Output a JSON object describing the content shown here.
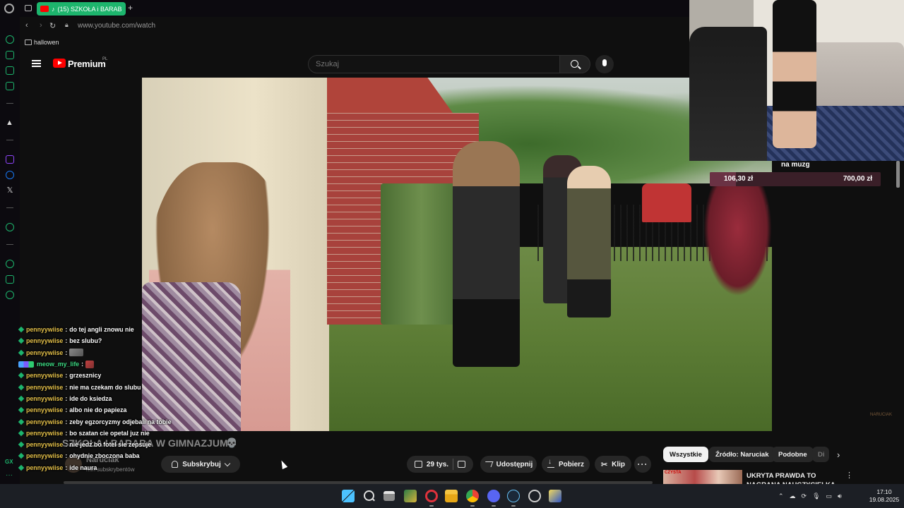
{
  "browser": {
    "tab": {
      "title": "(15) SZKOŁA i BARAB"
    },
    "url": "www.youtube.com/watch",
    "bookmark": "hallowen"
  },
  "youtube": {
    "brand": "Premium",
    "region": "PL",
    "search_placeholder": "Szukaj",
    "video_title": "SZKOŁA I BARABA W GIMNAZJUM",
    "channel": {
      "name": "Naruciak",
      "subscribers": "mln subskrybentów"
    },
    "actions": {
      "subscribe": "Subskrybuj",
      "likes": "29 tys.",
      "share": "Udostępnij",
      "download": "Pobierz",
      "clip": "Klip"
    },
    "chips": [
      "Wszystkie",
      "Źródło: Naruciak",
      "Podobne",
      "Di"
    ],
    "recommended": {
      "title": "UKRYTA PRAWDA TO NAGRANA NAUCZYCIELKA",
      "thumb_text": "CZYSTA"
    }
  },
  "stream": {
    "goal": {
      "title": "na muzg",
      "current": "106,30 zł",
      "target": "700,00 zł",
      "progress": 0.152
    },
    "watermark": "NARUCIAK",
    "chat": [
      {
        "user": "pennyywiise",
        "text": "do tej angli znowu nie"
      },
      {
        "user": "pennyywiise",
        "text": "bez slubu?"
      },
      {
        "user": "pennyywiise",
        "text": "",
        "emote": true
      },
      {
        "user": "meow_my_life",
        "text": "",
        "emote_red": true,
        "alt": true
      },
      {
        "user": "pennyywiise",
        "text": "grzesznicy"
      },
      {
        "user": "pennyywiise",
        "text": "nie ma czekam do slubu"
      },
      {
        "user": "pennyywiise",
        "text": "ide do ksiedza"
      },
      {
        "user": "pennyywiise",
        "text": "albo nie do papieza"
      },
      {
        "user": "pennyywiise",
        "text": "zeby egzorcyzmy odjebali na tobie"
      },
      {
        "user": "pennyywiise",
        "text": "bo szatan cie opetal juz nie"
      },
      {
        "user": "pennyywiise",
        "text": "nie jedz bo fotel sie zepsuje"
      },
      {
        "user": "pennyywiise",
        "text": "ohydnie zboczona baba"
      },
      {
        "user": "pennyywiise",
        "text": "ide naura"
      }
    ]
  },
  "sidebar_label": "GX",
  "taskbar": {
    "time": "17:10",
    "date": "19.08.2025"
  },
  "colors": {
    "accent": "#1db56d",
    "youtube_red": "#ff0000",
    "chat_user": "#e6c24a"
  }
}
